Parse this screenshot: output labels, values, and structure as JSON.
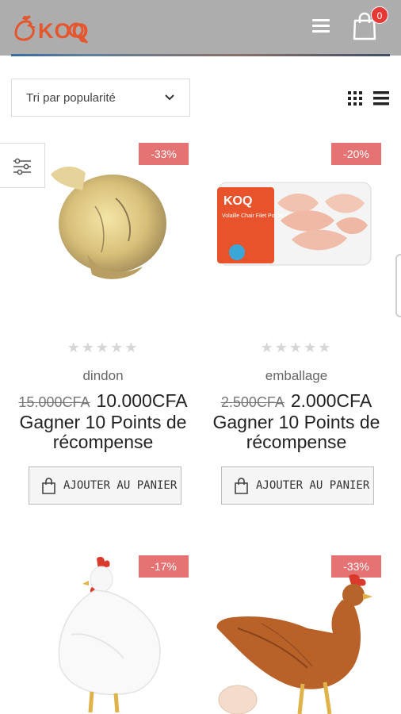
{
  "header": {
    "logo_text": "KOQ",
    "cart_count": "0"
  },
  "toolbar": {
    "sort_label": "Tri par popularité"
  },
  "products": [
    {
      "discount": "-33%",
      "category": "dindon",
      "old_price": "15.000CFA",
      "new_price": "10.000CFA",
      "points": "Gagner 10 Points de récompense",
      "button_label": "AJOUTER AU PANIER",
      "rating": 0
    },
    {
      "discount": "-20%",
      "category": "emballage",
      "old_price": "2.500CFA",
      "new_price": "2.000CFA",
      "points": "Gagner 10 Points de récompense",
      "button_label": "AJOUTER AU PANIER",
      "package_text": "Volaille Chair Filet Poulet Reconstitution",
      "rating": 0
    },
    {
      "discount": "-17%"
    },
    {
      "discount": "-33%"
    }
  ],
  "colors": {
    "header_bg": "#adadad",
    "brand": "#e4572e",
    "badge_bg": "#e57373",
    "cart_badge": "#e53935"
  }
}
